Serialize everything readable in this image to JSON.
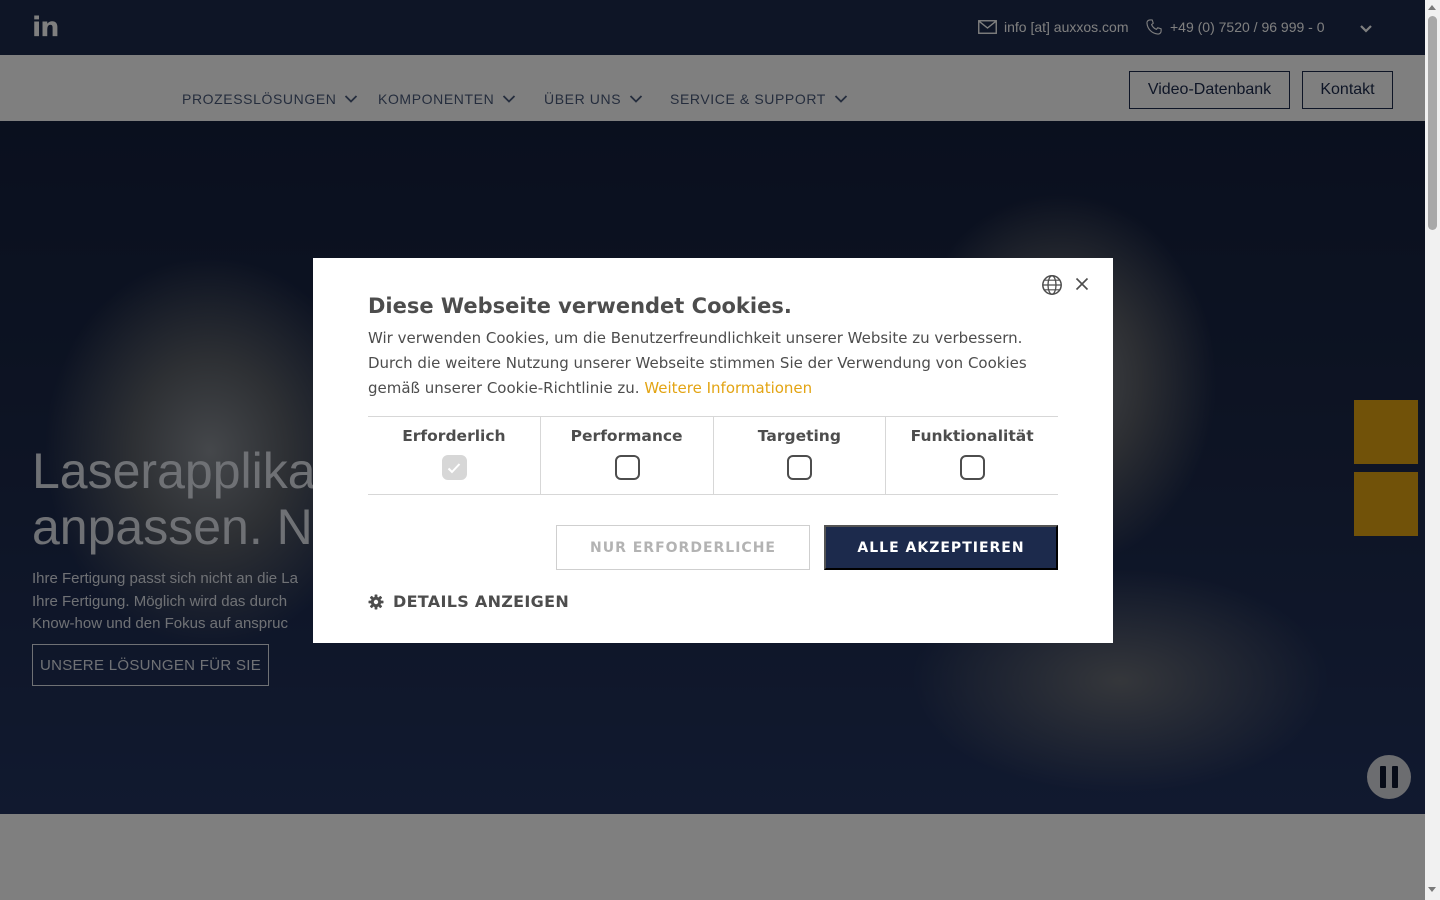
{
  "topbar": {
    "email": "info [at] auxxos.com",
    "phone": "+49 (0) 7520 / 96 999 - 0"
  },
  "nav": {
    "items": [
      "PROZESSLÖSUNGEN",
      "KOMPONENTEN",
      "ÜBER UNS",
      "SERVICE & SUPPORT"
    ],
    "video_button": "Video-Datenbank",
    "contact_button": "Kontakt"
  },
  "hero": {
    "title_line1": "Laserapplikati",
    "title_line2": "anpassen. Nic",
    "text": "Ihre Fertigung passt sich nicht an die La\nIhre Fertigung. Möglich wird das durch\nKnow-how und den Fokus auf anspruc",
    "cta": "UNSERE LÖSUNGEN FÜR SIE"
  },
  "colors": {
    "navy": "#1c2a4c",
    "gold": "#e3a413"
  },
  "cookie": {
    "title": "Diese Webseite verwendet Cookies.",
    "body": "Wir verwenden Cookies, um die Benutzerfreundlichkeit unserer Website zu verbessern. Durch die weitere Nutzung unserer Webseite stimmen Sie der Verwendung von Cookies gemäß unserer Cookie-Richtlinie zu. ",
    "link": "Weitere Informationen",
    "categories": [
      {
        "label": "Erforderlich",
        "checked": true
      },
      {
        "label": "Performance",
        "checked": false
      },
      {
        "label": "Targeting",
        "checked": false
      },
      {
        "label": "Funktionalität",
        "checked": false
      }
    ],
    "btn_necessary": "NUR ERFORDERLICHE",
    "btn_accept": "ALLE AKZEPTIEREN",
    "details": "DETAILS ANZEIGEN"
  },
  "icons": {
    "linkedin": "linkedin-icon",
    "email": "mail-icon",
    "phone": "phone-icon",
    "globe": "globe-icon",
    "close": "close-icon",
    "gear": "gear-icon",
    "pause": "pause-icon"
  }
}
